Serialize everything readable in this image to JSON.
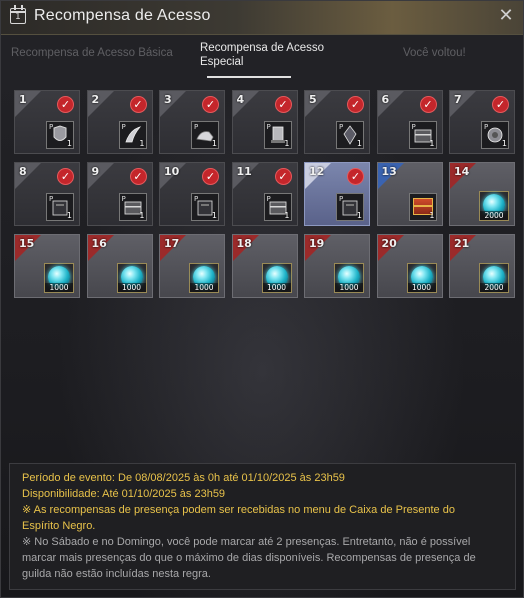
{
  "window": {
    "title": "Recompensa de Acesso"
  },
  "tabs": [
    {
      "label": "Recompensa de Acesso Básica",
      "active": false
    },
    {
      "label_line1": "Recompensa de Acesso",
      "label_line2": "Especial",
      "active": true
    },
    {
      "label": "Você voltou!",
      "active": false
    }
  ],
  "days": [
    {
      "day": "1",
      "claimed": true,
      "icon": "armor-icon",
      "qty": "1",
      "ptag": "P"
    },
    {
      "day": "2",
      "claimed": true,
      "icon": "feather-accessory-icon",
      "qty": "1",
      "ptag": "P"
    },
    {
      "day": "3",
      "claimed": true,
      "icon": "gloves-icon",
      "qty": "1",
      "ptag": "P"
    },
    {
      "day": "4",
      "claimed": true,
      "icon": "scroll-icon",
      "qty": "1",
      "ptag": "P"
    },
    {
      "day": "5",
      "claimed": true,
      "icon": "dark-crystal-icon",
      "qty": "1",
      "ptag": "P"
    },
    {
      "day": "6",
      "claimed": true,
      "icon": "chest-icon",
      "qty": "1",
      "ptag": "P"
    },
    {
      "day": "7",
      "claimed": true,
      "icon": "ornament-icon",
      "qty": "1",
      "ptag": "P"
    },
    {
      "day": "8",
      "claimed": true,
      "icon": "dark-box-icon",
      "qty": "1",
      "ptag": "P"
    },
    {
      "day": "9",
      "claimed": true,
      "icon": "chest-icon",
      "qty": "1",
      "ptag": "P"
    },
    {
      "day": "10",
      "claimed": true,
      "icon": "dark-box-icon",
      "qty": "1",
      "ptag": "P"
    },
    {
      "day": "11",
      "claimed": true,
      "icon": "chest-icon",
      "qty": "1",
      "ptag": "P"
    },
    {
      "day": "12",
      "claimed": true,
      "today": true,
      "icon": "dark-box-icon",
      "qty": "1",
      "ptag": "P"
    },
    {
      "day": "13",
      "claimed": false,
      "icon": "red-chest-icon",
      "qty": "1"
    },
    {
      "day": "14",
      "claimed": false,
      "icon": "blue-gem-icon",
      "qty": "2000"
    },
    {
      "day": "15",
      "claimed": false,
      "icon": "blue-gem-icon",
      "qty": "1000"
    },
    {
      "day": "16",
      "claimed": false,
      "icon": "blue-gem-icon",
      "qty": "1000"
    },
    {
      "day": "17",
      "claimed": false,
      "icon": "blue-gem-icon",
      "qty": "1000"
    },
    {
      "day": "18",
      "claimed": false,
      "icon": "blue-gem-icon",
      "qty": "1000"
    },
    {
      "day": "19",
      "claimed": false,
      "icon": "blue-gem-icon",
      "qty": "1000"
    },
    {
      "day": "20",
      "claimed": false,
      "icon": "blue-gem-icon",
      "qty": "1000"
    },
    {
      "day": "21",
      "claimed": false,
      "icon": "blue-gem-icon",
      "qty": "2000"
    }
  ],
  "info": {
    "period": "Período de evento: De 08/08/2025 às 0h até 01/10/2025 às 23h59",
    "availability": "Disponibilidade: Até 01/10/2025 às 23h59",
    "note1_line1": "※ As recompensas de presença podem ser recebidas no menu de Caixa de Presente do",
    "note1_line2": "Espírito Negro.",
    "note2_line1": "※ No Sábado e no Domingo, você pode marcar até 2 presenças. Entretanto, não é possível",
    "note2_line2": "marcar mais presenças do que o máximo de dias disponíveis. Recompensas de presença de",
    "note2_line3": "guilda não estão incluídas nesta regra."
  },
  "colors": {
    "accent_gold": "#e8c24a",
    "check_red": "#c4262b",
    "today_blue": "#7b86ad"
  }
}
